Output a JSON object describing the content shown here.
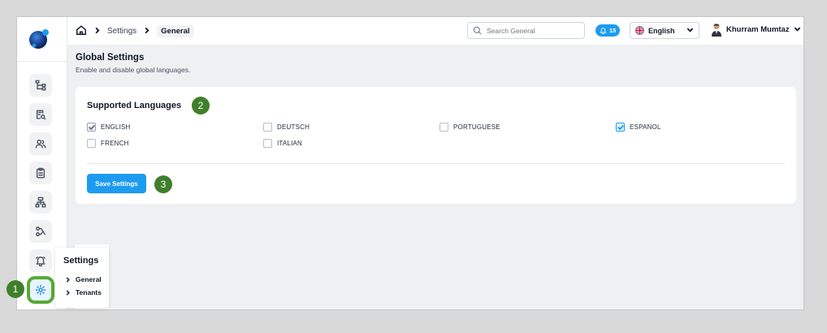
{
  "breadcrumb": {
    "items": [
      "Settings",
      "General"
    ]
  },
  "search": {
    "placeholder": "Search General",
    "value": ""
  },
  "notifications": {
    "count": "15"
  },
  "language_select": {
    "selected": "English"
  },
  "user": {
    "name": "Khurram Mumtaz"
  },
  "page": {
    "title": "Global Settings",
    "subtitle": "Enable and disable global languages."
  },
  "card": {
    "title": "Supported Languages",
    "languages": [
      {
        "label": "ENGLISH",
        "checked": true
      },
      {
        "label": "DEUTSCH",
        "checked": false
      },
      {
        "label": "PORTUGUESE",
        "checked": false
      },
      {
        "label": "ESPANOL",
        "checked": true
      },
      {
        "label": "FRENCH",
        "checked": false
      },
      {
        "label": "ITALIAN",
        "checked": false
      }
    ],
    "save_label": "Save Settings"
  },
  "flyout": {
    "title": "Settings",
    "items": [
      "General",
      "Tenants"
    ]
  },
  "steps": [
    "1",
    "2",
    "3"
  ],
  "colors": {
    "accent": "#1d9bf0",
    "step_badge": "#3f7f2b",
    "highlight": "#57a935"
  },
  "icons": {
    "rail": [
      "hierarchy-icon",
      "document-search-icon",
      "users-icon",
      "clipboard-icon",
      "sitemap-icon",
      "workflow-icon",
      "bell-icon",
      "gear-icon"
    ]
  }
}
